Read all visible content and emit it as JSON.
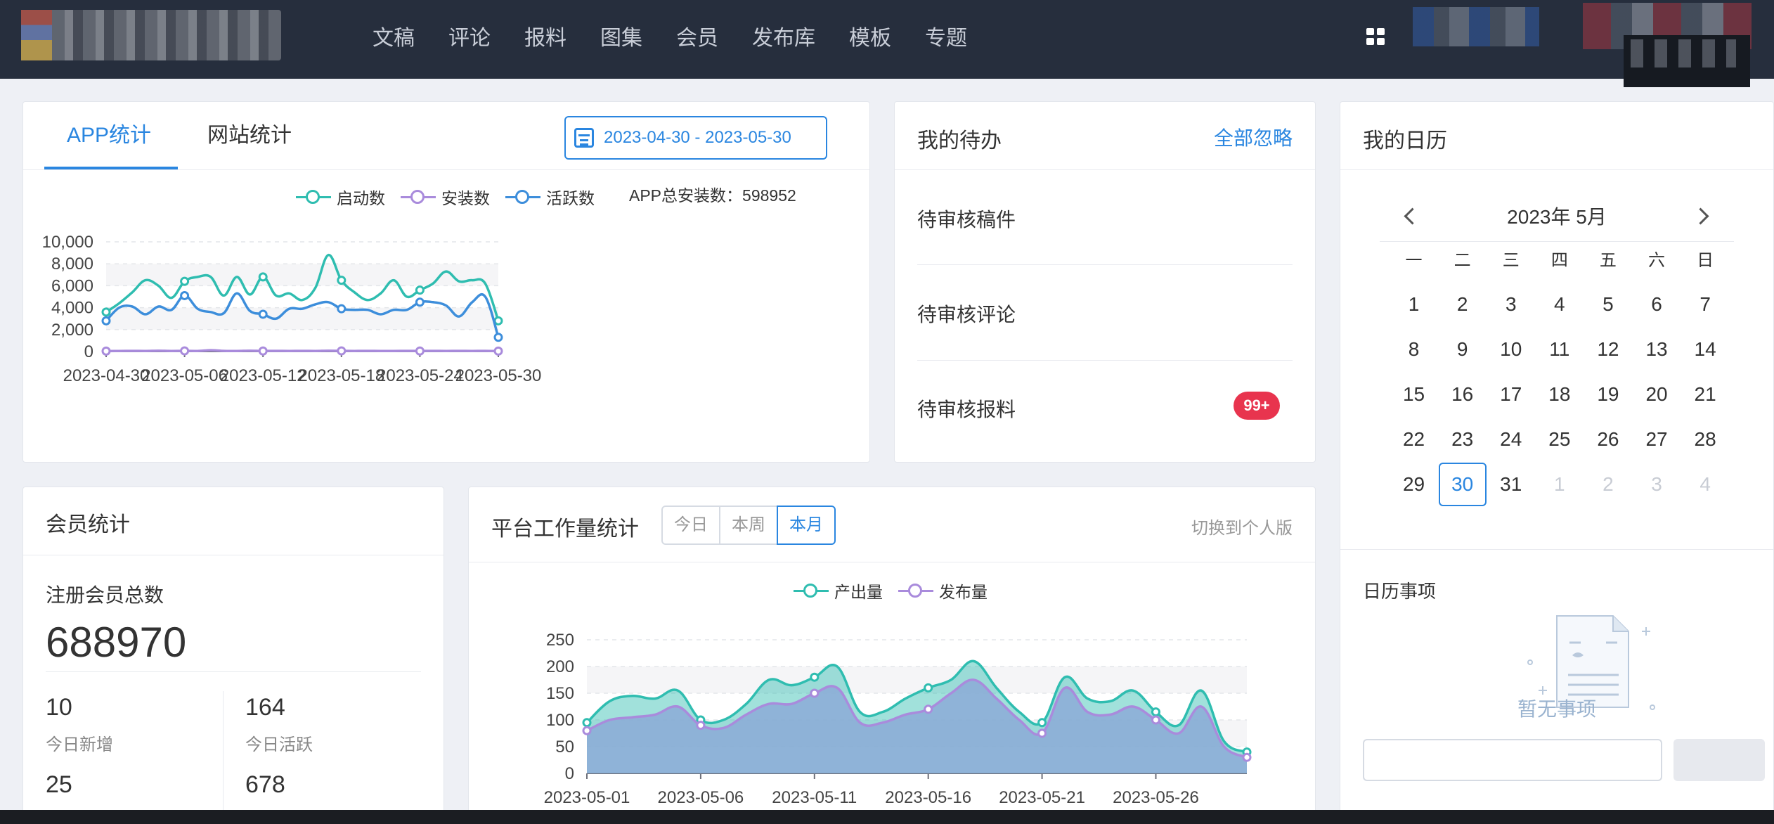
{
  "nav": {
    "items": [
      "文稿",
      "评论",
      "报料",
      "图集",
      "会员",
      "发布库",
      "模板",
      "专题"
    ]
  },
  "app_stats": {
    "tabs": [
      "APP统计",
      "网站统计"
    ],
    "date_range": "2023-04-30 - 2023-05-30",
    "total_install_label": "APP总安装数：598952"
  },
  "todo": {
    "title": "我的待办",
    "ignore_all": "全部忽略",
    "items": [
      {
        "label": "待审核稿件",
        "badge": ""
      },
      {
        "label": "待审核评论",
        "badge": ""
      },
      {
        "label": "待审核报料",
        "badge": "99+"
      }
    ]
  },
  "calendar": {
    "title": "我的日历",
    "month_label": "2023年 5月",
    "weekdays": [
      "一",
      "二",
      "三",
      "四",
      "五",
      "六",
      "日"
    ],
    "days": [
      {
        "d": "1",
        "muted": false
      },
      {
        "d": "2",
        "muted": false
      },
      {
        "d": "3",
        "muted": false
      },
      {
        "d": "4",
        "muted": false
      },
      {
        "d": "5",
        "muted": false
      },
      {
        "d": "6",
        "muted": false
      },
      {
        "d": "7",
        "muted": false
      },
      {
        "d": "8",
        "muted": false
      },
      {
        "d": "9",
        "muted": false
      },
      {
        "d": "10",
        "muted": false
      },
      {
        "d": "11",
        "muted": false
      },
      {
        "d": "12",
        "muted": false
      },
      {
        "d": "13",
        "muted": false
      },
      {
        "d": "14",
        "muted": false
      },
      {
        "d": "15",
        "muted": false
      },
      {
        "d": "16",
        "muted": false
      },
      {
        "d": "17",
        "muted": false
      },
      {
        "d": "18",
        "muted": false
      },
      {
        "d": "19",
        "muted": false
      },
      {
        "d": "20",
        "muted": false
      },
      {
        "d": "21",
        "muted": false
      },
      {
        "d": "22",
        "muted": false
      },
      {
        "d": "23",
        "muted": false
      },
      {
        "d": "24",
        "muted": false
      },
      {
        "d": "25",
        "muted": false
      },
      {
        "d": "26",
        "muted": false
      },
      {
        "d": "27",
        "muted": false
      },
      {
        "d": "28",
        "muted": false
      },
      {
        "d": "29",
        "muted": false
      },
      {
        "d": "30",
        "muted": false,
        "today": true
      },
      {
        "d": "31",
        "muted": false
      },
      {
        "d": "1",
        "muted": true
      },
      {
        "d": "2",
        "muted": true
      },
      {
        "d": "3",
        "muted": true
      },
      {
        "d": "4",
        "muted": true
      }
    ],
    "events_title": "日历事项",
    "events_empty": "暂无事项"
  },
  "member": {
    "title": "会员统计",
    "total_label": "注册会员总数",
    "total_value": "688970",
    "stats": [
      {
        "value": "10",
        "label": "今日新增"
      },
      {
        "value": "164",
        "label": "今日活跃"
      },
      {
        "value": "25",
        "label": ""
      },
      {
        "value": "678",
        "label": ""
      }
    ]
  },
  "workload": {
    "title": "平台工作量统计",
    "ranges": [
      "今日",
      "本周",
      "本月"
    ],
    "active_range": "本月",
    "switch_label": "切换到个人版"
  },
  "colors": {
    "teal": "#2fbdb0",
    "blue": "#3d8edb",
    "purple": "#a98bdc",
    "accent": "#2a86e0",
    "badge": "#e8344e"
  },
  "chart_data": [
    {
      "type": "line",
      "x": [
        "2023-04-30",
        "2023-05-01",
        "2023-05-02",
        "2023-05-03",
        "2023-05-04",
        "2023-05-05",
        "2023-05-06",
        "2023-05-07",
        "2023-05-08",
        "2023-05-09",
        "2023-05-10",
        "2023-05-11",
        "2023-05-12",
        "2023-05-13",
        "2023-05-14",
        "2023-05-15",
        "2023-05-16",
        "2023-05-17",
        "2023-05-18",
        "2023-05-19",
        "2023-05-20",
        "2023-05-21",
        "2023-05-22",
        "2023-05-23",
        "2023-05-24",
        "2023-05-25",
        "2023-05-26",
        "2023-05-27",
        "2023-05-28",
        "2023-05-29",
        "2023-05-30"
      ],
      "xticks": [
        "2023-04-30",
        "2023-05-06",
        "2023-05-12",
        "2023-05-18",
        "2023-05-24",
        "2023-05-30"
      ],
      "series": [
        {
          "name": "启动数",
          "color": "#2fbdb0",
          "values": [
            3600,
            4400,
            5400,
            6500,
            6000,
            4900,
            6400,
            6800,
            6800,
            5100,
            6800,
            5200,
            6800,
            5100,
            5300,
            4700,
            5800,
            8800,
            6500,
            5400,
            4700,
            5300,
            6500,
            5000,
            5600,
            6200,
            7300,
            6400,
            6500,
            6200,
            2800
          ]
        },
        {
          "name": "安装数",
          "color": "#a98bdc",
          "values": [
            40,
            50,
            60,
            50,
            70,
            50,
            60,
            50,
            120,
            60,
            50,
            70,
            50,
            60,
            50,
            60,
            50,
            70,
            60,
            50,
            60,
            50,
            50,
            60,
            50,
            60,
            50,
            60,
            50,
            60,
            40
          ]
        },
        {
          "name": "活跃数",
          "color": "#3d8edb",
          "values": [
            2800,
            4000,
            4100,
            3400,
            4100,
            3800,
            5100,
            3900,
            3600,
            3500,
            5300,
            3700,
            3400,
            3000,
            3900,
            3900,
            4300,
            4500,
            3900,
            3800,
            3800,
            3400,
            3800,
            3800,
            4500,
            4500,
            4200,
            3200,
            4500,
            5000,
            1300
          ]
        }
      ],
      "ylim": [
        0,
        10000
      ],
      "yticks": [
        "0",
        "2,000",
        "4,000",
        "6,000",
        "8,000",
        "10,000"
      ]
    },
    {
      "type": "area",
      "x": [
        "2023-05-01",
        "2023-05-02",
        "2023-05-03",
        "2023-05-04",
        "2023-05-05",
        "2023-05-06",
        "2023-05-07",
        "2023-05-08",
        "2023-05-09",
        "2023-05-10",
        "2023-05-11",
        "2023-05-12",
        "2023-05-13",
        "2023-05-14",
        "2023-05-15",
        "2023-05-16",
        "2023-05-17",
        "2023-05-18",
        "2023-05-19",
        "2023-05-20",
        "2023-05-21",
        "2023-05-22",
        "2023-05-23",
        "2023-05-24",
        "2023-05-25",
        "2023-05-26",
        "2023-05-27",
        "2023-05-28",
        "2023-05-29",
        "2023-05-30"
      ],
      "xticks": [
        "2023-05-01",
        "2023-05-06",
        "2023-05-11",
        "2023-05-16",
        "2023-05-21",
        "2023-05-26"
      ],
      "series": [
        {
          "name": "产出量",
          "color": "#2fbdb0",
          "values": [
            95,
            135,
            145,
            140,
            155,
            100,
            100,
            130,
            175,
            165,
            180,
            200,
            115,
            115,
            140,
            160,
            175,
            210,
            160,
            115,
            95,
            180,
            140,
            135,
            155,
            115,
            90,
            155,
            60,
            40
          ]
        },
        {
          "name": "发布量",
          "color": "#a98bdc",
          "values": [
            80,
            100,
            105,
            110,
            125,
            90,
            85,
            110,
            130,
            130,
            150,
            160,
            95,
            95,
            110,
            120,
            150,
            175,
            140,
            100,
            75,
            160,
            115,
            110,
            125,
            100,
            75,
            125,
            50,
            30
          ]
        }
      ],
      "ylim": [
        0,
        250
      ],
      "yticks": [
        "0",
        "50",
        "100",
        "150",
        "200",
        "250"
      ]
    }
  ]
}
